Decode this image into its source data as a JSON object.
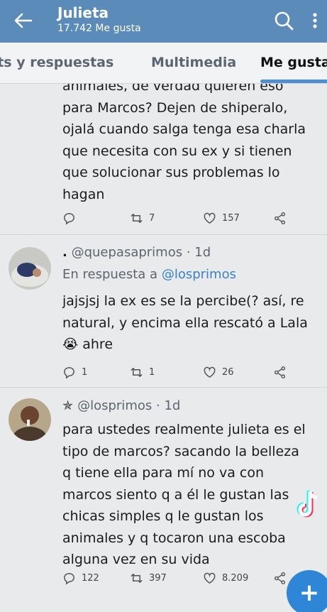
{
  "header": {
    "title": "Julieta",
    "subtitle": "17.742 Me gusta"
  },
  "tabs": [
    {
      "label": "Tweets y respuestas"
    },
    {
      "label": "Multimedia"
    },
    {
      "label": "Me gusta"
    }
  ],
  "tweets": [
    {
      "lines": [
        "animales, de verdad quieren eso",
        "para Marcos? Dejen de shiperalo,",
        "ojalá cuando salga tenga esa charla",
        "que necesita con su ex y si tienen",
        "que solucionar sus problemas lo",
        "hagan"
      ],
      "replies": "",
      "retweets": "7",
      "likes": "157"
    },
    {
      "handle": "@quepasaprimos",
      "time": "1d",
      "reply_prefix": "En respuesta a",
      "reply_to": "@losprimos",
      "lines": [
        "jajsjsj la ex es se la percibe(? así, re",
        "natural, y encima ella rescató a Lala"
      ],
      "last_line": "ahre",
      "emoji": "😭",
      "replies": "1",
      "retweets": "1",
      "likes": "26"
    },
    {
      "handle": "@losprimos",
      "time": "1d",
      "lines": [
        "para ustedes realmente julieta es el",
        "tipo de marcos? sacando la belleza",
        "q tiene ella para mí no va con",
        "marcos siento q a él le gustan las",
        "chicas simples q le gustan los",
        "animales y q tocaron una escoba",
        "alguna vez en su vida"
      ],
      "replies": "122",
      "retweets": "397",
      "likes": "8.209"
    }
  ],
  "fab_label": "+"
}
